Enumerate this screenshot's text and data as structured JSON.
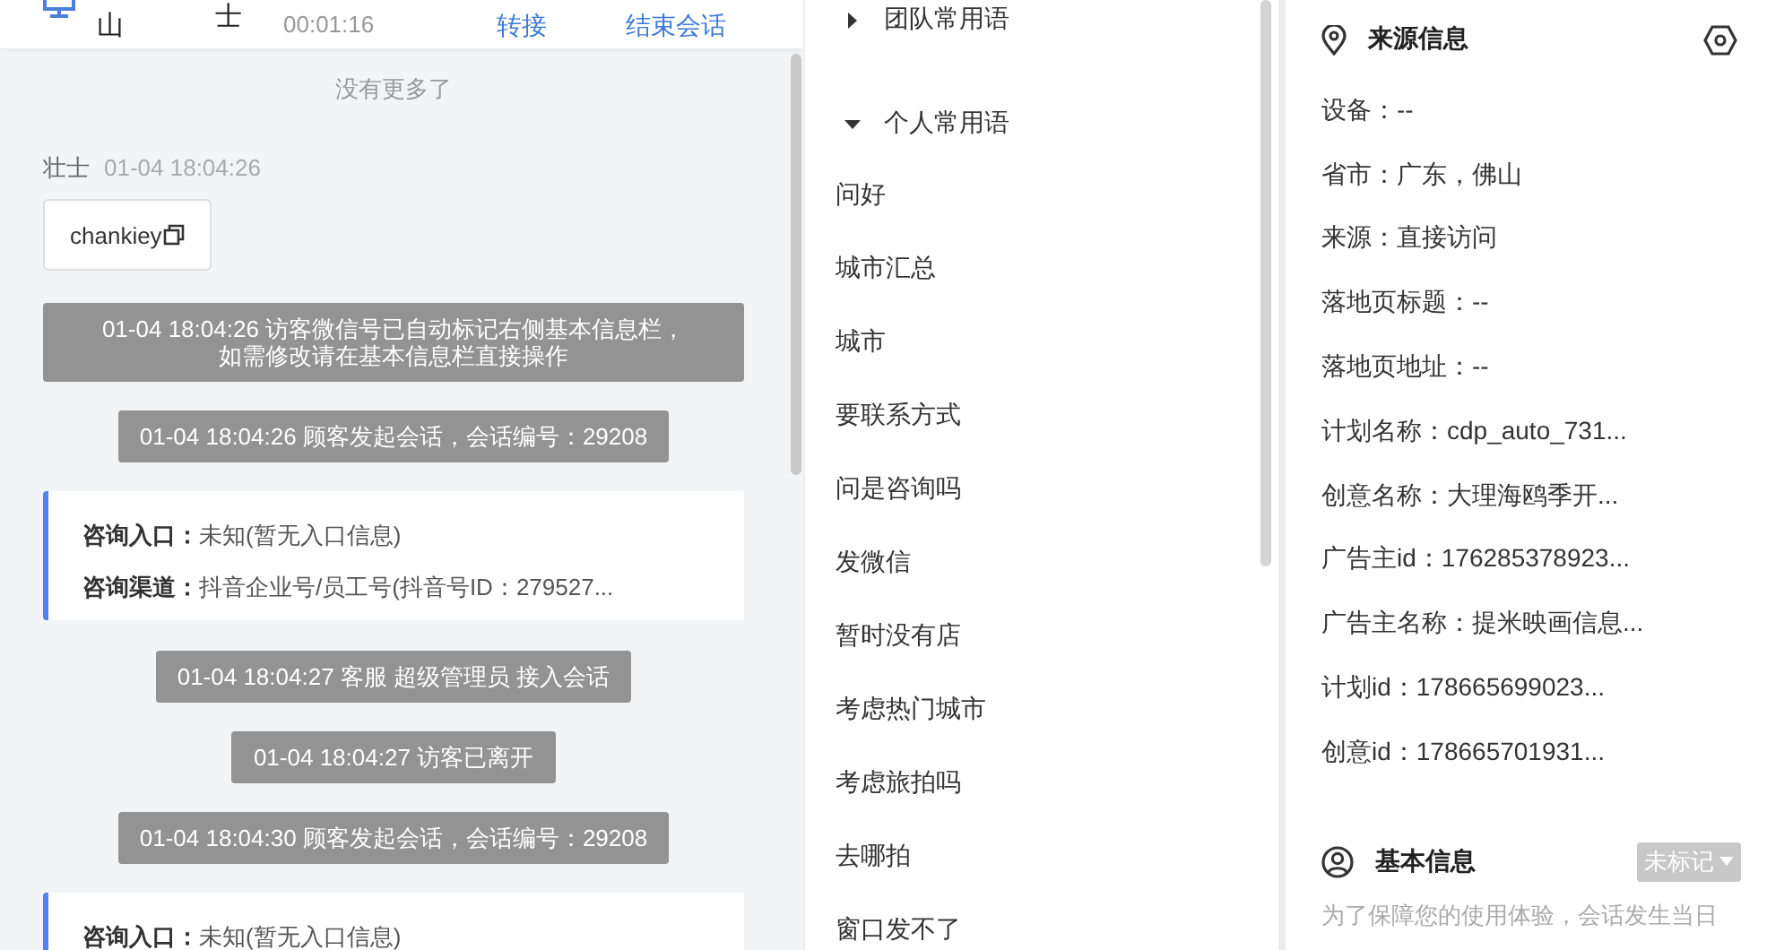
{
  "header": {
    "visitor_name_parts": [
      "山",
      "士"
    ],
    "timer": "00:01:16",
    "actions": [
      "转接",
      "结束会话"
    ]
  },
  "chat": {
    "no_more": "没有更多了",
    "messages": [
      {
        "kind": "visitor",
        "sender": "壮士",
        "time": "01-04 18:04:26",
        "text": "chankiey"
      },
      {
        "kind": "system",
        "lines": [
          "01-04 18:04:26 访客微信号已自动标记右侧基本信息栏，",
          "如需修改请在基本信息栏直接操作"
        ]
      },
      {
        "kind": "system",
        "text": "01-04 18:04:26 顾客发起会话，会话编号：29208"
      },
      {
        "kind": "entry",
        "rows": [
          {
            "label": "咨询入口：",
            "value": "未知(暂无入口信息)"
          },
          {
            "label": "咨询渠道：",
            "value": "抖音企业号/员工号(抖音号ID：279527..."
          }
        ]
      },
      {
        "kind": "system",
        "text": "01-04 18:04:27 客服 超级管理员 接入会话"
      },
      {
        "kind": "system",
        "text": "01-04 18:04:27 访客已离开"
      },
      {
        "kind": "system",
        "text": "01-04 18:04:30 顾客发起会话，会话编号：29208"
      },
      {
        "kind": "entry",
        "rows": [
          {
            "label": "咨询入口：",
            "value": "未知(暂无入口信息)"
          }
        ]
      }
    ]
  },
  "phrases": [
    {
      "title": "团队常用语",
      "expanded": false
    },
    {
      "title": "个人常用语",
      "expanded": true,
      "items": [
        "问好",
        "城市汇总",
        "城市",
        "要联系方式",
        "问是咨询吗",
        "发微信",
        "暂时没有店",
        "考虑热门城市",
        "考虑旅拍吗",
        "去哪拍",
        "窗口发不了"
      ]
    }
  ],
  "source_info": {
    "title": "来源信息",
    "fields": [
      "设备：--",
      "省市：广东，佛山",
      "来源：直接访问",
      "落地页标题：--",
      "落地页地址：--",
      "计划名称：cdp_auto_731...",
      "创意名称：大理海鸥季开...",
      "广告主id：176285378923...",
      "广告主名称：提米映画信息...",
      "计划id：178665699023...",
      "创意id：178665701931..."
    ]
  },
  "basic_info": {
    "title": "基本信息",
    "tag": "未标记",
    "note": "为了保障您的使用体验，会话发生当日"
  }
}
